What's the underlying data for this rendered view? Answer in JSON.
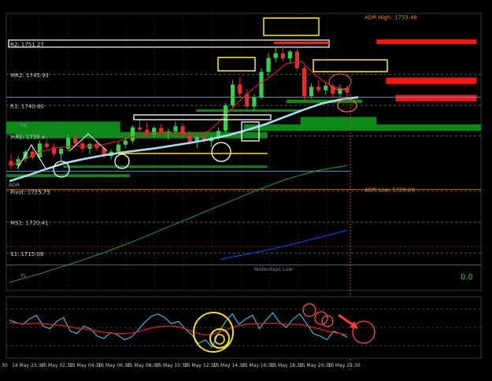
{
  "chart_data": [
    {
      "type": "candlestick",
      "title": "",
      "xlabel": "",
      "ylabel": "",
      "ylim": [
        1708.6,
        1756.5
      ],
      "grid": true,
      "y_range_note": "",
      "levels": [
        {
          "label": "R2: 1751.27",
          "value": 1751.27,
          "color": "#ffffff",
          "style": "box"
        },
        {
          "label": "MR2: 1745.93",
          "value": 1745.93,
          "color": "#9a9a9a",
          "style": "dashed"
        },
        {
          "label": "R1: 1740.60",
          "value": 1740.6,
          "color": "#9a9a9a",
          "style": "dashed"
        },
        {
          "label": "MR1: 1735.x",
          "value": 1735.3,
          "color": "#9a9a9a",
          "style": "dashed"
        },
        {
          "label": "Pivot: 1725.75",
          "value": 1725.75,
          "color": "#9a9a9a",
          "style": "dashed"
        },
        {
          "label": "MS1: 1720.41",
          "value": 1720.41,
          "color": "#9a9a9a",
          "style": "dashed"
        },
        {
          "label": "S1: 1715.08",
          "value": 1715.08,
          "color": "#9a9a9a",
          "style": "dashed"
        }
      ],
      "right_labels": [
        {
          "label": "ADR High: 1753.48",
          "value": 1755.9,
          "color": "#e08a2c"
        },
        {
          "label": "ADR Low: 1726.06",
          "value": 1726.06,
          "color": "#e08a2c"
        }
      ],
      "text_marks": [
        {
          "label": "YH",
          "value": 1737.2
        },
        {
          "label": "ADR",
          "value": 1727.0
        },
        {
          "label": "YL",
          "value": 1711.3
        },
        {
          "label": "Yesterdays Low",
          "value": 1712.4
        }
      ],
      "readout": "0.0",
      "x_ticks": [
        "14 May 23:30",
        "15 May 02:30",
        "15 May 04:30",
        "15 May 06:30",
        "15 May 08:30",
        "15 May 10:30",
        "15 May 12:30",
        "15 May 14:30",
        "15 May 16:30",
        "15 May 18:30",
        "15 May 20:30",
        "15 May 22:30"
      ],
      "zones_green": [
        {
          "x0": 0,
          "x1": 0.24,
          "y0": 1737.8,
          "y1": 1735.6
        },
        {
          "x0": 0.02,
          "x1": 0.55,
          "y0": 1736.0,
          "y1": 1734.9
        },
        {
          "x0": 0.4,
          "x1": 0.62,
          "y0": 1739.9,
          "y1": 1739.5
        },
        {
          "x0": 0.62,
          "x1": 0.78,
          "y0": 1738.6,
          "y1": 1737.2
        },
        {
          "x0": 0.5,
          "x1": 1.0,
          "y0": 1737.3,
          "y1": 1736.2
        },
        {
          "x0": 0.0,
          "x1": 0.26,
          "y0": 1728.7,
          "y1": 1728.2
        },
        {
          "x0": 0.12,
          "x1": 0.55,
          "y0": 1730.2,
          "y1": 1729.8
        },
        {
          "x0": 0.59,
          "x1": 0.75,
          "y0": 1741.6,
          "y1": 1741.0
        }
      ],
      "zones_red": [
        {
          "x0": 0.78,
          "x1": 0.99,
          "y0": 1752.0,
          "y1": 1751.2
        },
        {
          "x0": 0.8,
          "x1": 0.99,
          "y0": 1745.4,
          "y1": 1744.3
        },
        {
          "x0": 0.82,
          "x1": 0.99,
          "y0": 1742.4,
          "y1": 1741.3
        }
      ],
      "ohlc": [
        [
          1731.0,
          1732.2,
          1729.5,
          1730.2
        ],
        [
          1730.2,
          1731.8,
          1729.6,
          1731.3
        ],
        [
          1731.3,
          1733.0,
          1730.8,
          1732.6
        ],
        [
          1732.6,
          1733.4,
          1731.2,
          1731.6
        ],
        [
          1731.6,
          1734.5,
          1731.2,
          1734.0
        ],
        [
          1734.0,
          1735.2,
          1733.0,
          1733.4
        ],
        [
          1733.4,
          1734.0,
          1731.8,
          1732.2
        ],
        [
          1732.2,
          1733.5,
          1731.0,
          1733.1
        ],
        [
          1733.1,
          1735.6,
          1732.6,
          1735.0
        ],
        [
          1735.0,
          1735.8,
          1733.6,
          1734.0
        ],
        [
          1734.0,
          1734.8,
          1732.5,
          1733.1
        ],
        [
          1733.1,
          1734.2,
          1732.2,
          1733.9
        ],
        [
          1733.9,
          1734.6,
          1732.8,
          1733.2
        ],
        [
          1733.2,
          1733.6,
          1731.4,
          1731.8
        ],
        [
          1731.8,
          1733.0,
          1731.2,
          1732.6
        ],
        [
          1732.6,
          1734.2,
          1732.2,
          1733.8
        ],
        [
          1733.8,
          1735.0,
          1733.2,
          1734.5
        ],
        [
          1734.5,
          1737.2,
          1734.0,
          1736.8
        ],
        [
          1736.8,
          1738.3,
          1736.0,
          1736.4
        ],
        [
          1736.4,
          1737.6,
          1735.2,
          1735.6
        ],
        [
          1735.6,
          1737.0,
          1735.0,
          1736.7
        ],
        [
          1736.7,
          1737.4,
          1735.4,
          1735.8
        ],
        [
          1735.8,
          1736.6,
          1734.6,
          1736.1
        ],
        [
          1736.1,
          1737.8,
          1735.6,
          1737.0
        ],
        [
          1737.0,
          1737.6,
          1735.0,
          1735.5
        ],
        [
          1735.5,
          1736.2,
          1733.8,
          1734.3
        ],
        [
          1734.3,
          1735.6,
          1733.2,
          1735.1
        ],
        [
          1735.1,
          1736.0,
          1734.0,
          1734.4
        ],
        [
          1734.4,
          1735.4,
          1733.4,
          1735.0
        ],
        [
          1735.0,
          1736.8,
          1734.6,
          1736.2
        ],
        [
          1736.2,
          1741.0,
          1735.8,
          1740.6
        ],
        [
          1740.6,
          1745.0,
          1740.0,
          1744.2
        ],
        [
          1744.2,
          1745.5,
          1742.0,
          1742.6
        ],
        [
          1742.6,
          1743.4,
          1740.0,
          1740.4
        ],
        [
          1740.4,
          1742.5,
          1739.6,
          1742.0
        ],
        [
          1742.0,
          1747.0,
          1741.6,
          1746.4
        ],
        [
          1746.4,
          1749.6,
          1745.6,
          1748.8
        ],
        [
          1748.8,
          1750.8,
          1748.0,
          1749.6
        ],
        [
          1749.6,
          1751.0,
          1748.2,
          1748.7
        ],
        [
          1748.7,
          1750.2,
          1747.8,
          1749.9
        ],
        [
          1749.9,
          1750.4,
          1746.6,
          1747.0
        ],
        [
          1747.0,
          1747.4,
          1741.6,
          1742.2
        ],
        [
          1742.2,
          1744.4,
          1741.8,
          1743.8
        ],
        [
          1743.8,
          1745.0,
          1742.8,
          1743.2
        ],
        [
          1743.2,
          1744.6,
          1742.4,
          1744.0
        ],
        [
          1744.0,
          1744.4,
          1741.8,
          1742.6
        ],
        [
          1742.6,
          1744.2,
          1742.0,
          1743.6
        ],
        [
          1743.6,
          1744.0,
          1742.2,
          1742.8
        ]
      ],
      "ma_white": [
        1727.5,
        1728.5,
        1729.6,
        1730.6,
        1731.3,
        1731.9,
        1732.4,
        1732.8,
        1733.2,
        1733.7,
        1734.2,
        1734.8,
        1735.5,
        1736.4,
        1737.4,
        1738.6,
        1739.8,
        1740.9,
        1741.6,
        1742.0
      ],
      "ma_red": [
        1730.2,
        1731.4,
        1732.6,
        1733.2,
        1733.6,
        1733.5,
        1733.8,
        1734.4,
        1735.2,
        1735.8,
        1736.0,
        1735.6,
        1735.4,
        1736.2,
        1738.8,
        1741.5,
        1743.8,
        1745.6,
        1747.8,
        1748.2,
        1745.6,
        1743.9,
        1743.2
      ],
      "ma_green": [
        1710.0,
        1711.5,
        1713.2,
        1715.0,
        1717.0,
        1719.2,
        1721.4,
        1723.6,
        1725.8,
        1727.8,
        1729.3,
        1730.2
      ],
      "ma_blue": [
        1714.0,
        1714.6,
        1715.2,
        1715.9,
        1716.6,
        1717.4,
        1718.2,
        1719.0
      ]
    },
    {
      "type": "line",
      "title": "",
      "xlabel": "",
      "ylabel": "",
      "ylim": [
        0,
        100
      ],
      "grid": true,
      "series": [
        {
          "values": [
            62,
            58,
            55,
            64,
            70,
            52,
            48,
            60,
            66,
            44,
            40,
            52,
            48,
            36,
            32,
            42,
            38,
            30,
            34,
            45,
            58,
            68,
            72,
            66,
            56,
            60,
            48,
            38,
            24,
            30,
            18,
            42,
            60,
            72,
            55,
            64,
            70,
            48,
            62,
            74,
            58,
            50,
            64,
            72,
            56,
            40,
            36,
            30,
            44,
            40,
            34
          ]
        },
        {
          "values": [
            58,
            57,
            56,
            56,
            57,
            56,
            55,
            54,
            53,
            51,
            49,
            48,
            46,
            44,
            42,
            41,
            40,
            40,
            41,
            43,
            46,
            49,
            51,
            52,
            52,
            51,
            48,
            44,
            40,
            38,
            39,
            42,
            46,
            50,
            53,
            55,
            56,
            56,
            57,
            57,
            56,
            55,
            55,
            55,
            53,
            50,
            47,
            44,
            42,
            40,
            38
          ]
        }
      ]
    }
  ]
}
